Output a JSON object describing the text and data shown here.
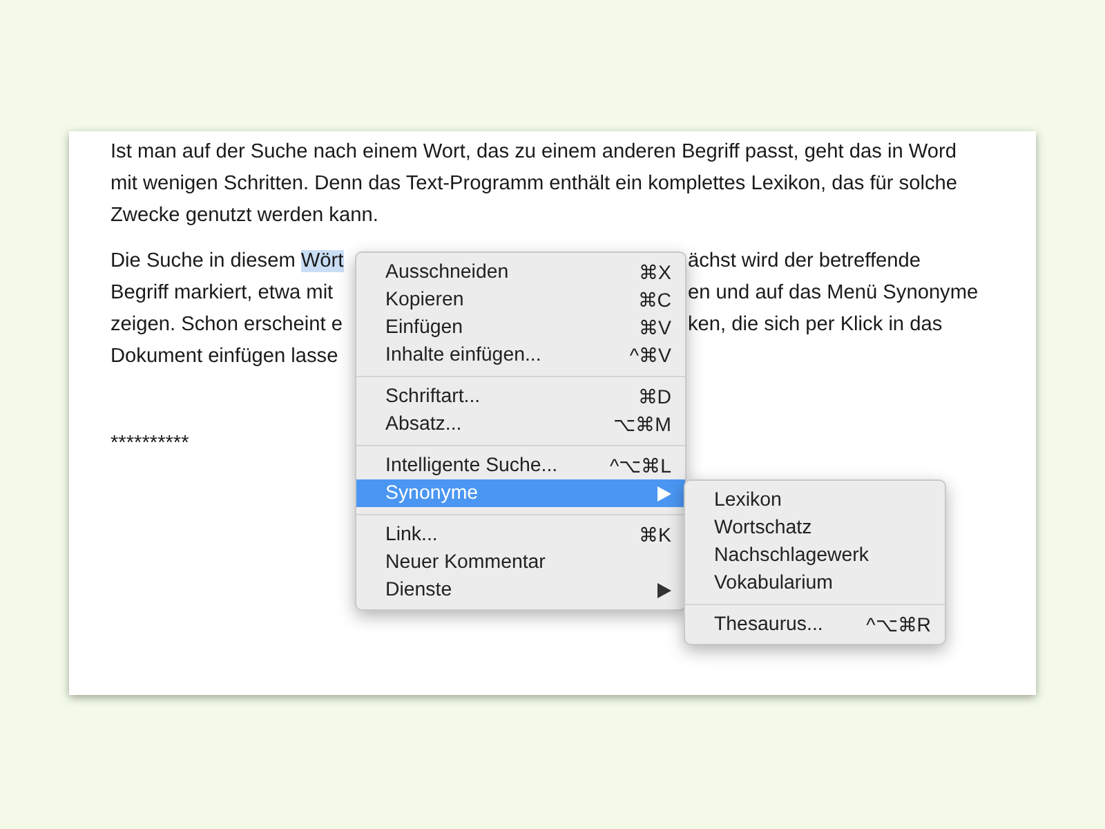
{
  "document": {
    "paragraph_1": "Ist man auf der Suche nach einem Wort, das zu einem anderen Begriff passt, geht das in Word mit wenigen Schritten. Denn das Text-Programm enthält ein komplettes Lexikon, das für solche Zwecke genutzt werden kann.",
    "paragraph_2_lines": [
      {
        "left": "Die Suche in diesem ",
        "selection": "Wört",
        "right": "ächst wird der betreffende"
      },
      {
        "left": "Begriff markiert, etwa mit",
        "right": "en und auf das Menü Synonyme"
      },
      {
        "left": "zeigen. Schon erscheint e",
        "right": "ken, die sich per Klick in das"
      },
      {
        "left": "Dokument einfügen lasse"
      }
    ],
    "separator_line": "**********"
  },
  "context_menu": {
    "items": [
      {
        "kind": "item",
        "label": "Ausschneiden",
        "shortcut": "⌘X",
        "selected": false
      },
      {
        "kind": "item",
        "label": "Kopieren",
        "shortcut": "⌘C",
        "selected": false
      },
      {
        "kind": "item",
        "label": "Einfügen",
        "shortcut": "⌘V",
        "selected": false
      },
      {
        "kind": "item",
        "label": "Inhalte einfügen...",
        "shortcut": "^⌘V",
        "selected": false
      },
      {
        "kind": "separator"
      },
      {
        "kind": "item",
        "label": "Schriftart...",
        "shortcut": "⌘D",
        "selected": false
      },
      {
        "kind": "item",
        "label": "Absatz...",
        "shortcut": "⌥⌘M",
        "selected": false
      },
      {
        "kind": "separator"
      },
      {
        "kind": "item",
        "label": "Intelligente Suche...",
        "shortcut": "^⌥⌘L",
        "selected": false
      },
      {
        "kind": "item",
        "label": "Synonyme",
        "submenu": true,
        "selected": true
      },
      {
        "kind": "separator"
      },
      {
        "kind": "item",
        "label": "Link...",
        "shortcut": "⌘K",
        "selected": false
      },
      {
        "kind": "item",
        "label": "Neuer Kommentar",
        "selected": false
      },
      {
        "kind": "item",
        "label": "Dienste",
        "submenu": true,
        "selected": false
      }
    ]
  },
  "submenu": {
    "items": [
      {
        "kind": "item",
        "label": "Lexikon",
        "selected": false
      },
      {
        "kind": "item",
        "label": "Wortschatz",
        "selected": false
      },
      {
        "kind": "item",
        "label": "Nachschlagewerk",
        "selected": false
      },
      {
        "kind": "item",
        "label": "Vokabularium",
        "selected": false
      },
      {
        "kind": "separator"
      },
      {
        "kind": "item",
        "label": "Thesaurus...",
        "shortcut": "^⌥⌘R",
        "selected": false
      }
    ]
  }
}
